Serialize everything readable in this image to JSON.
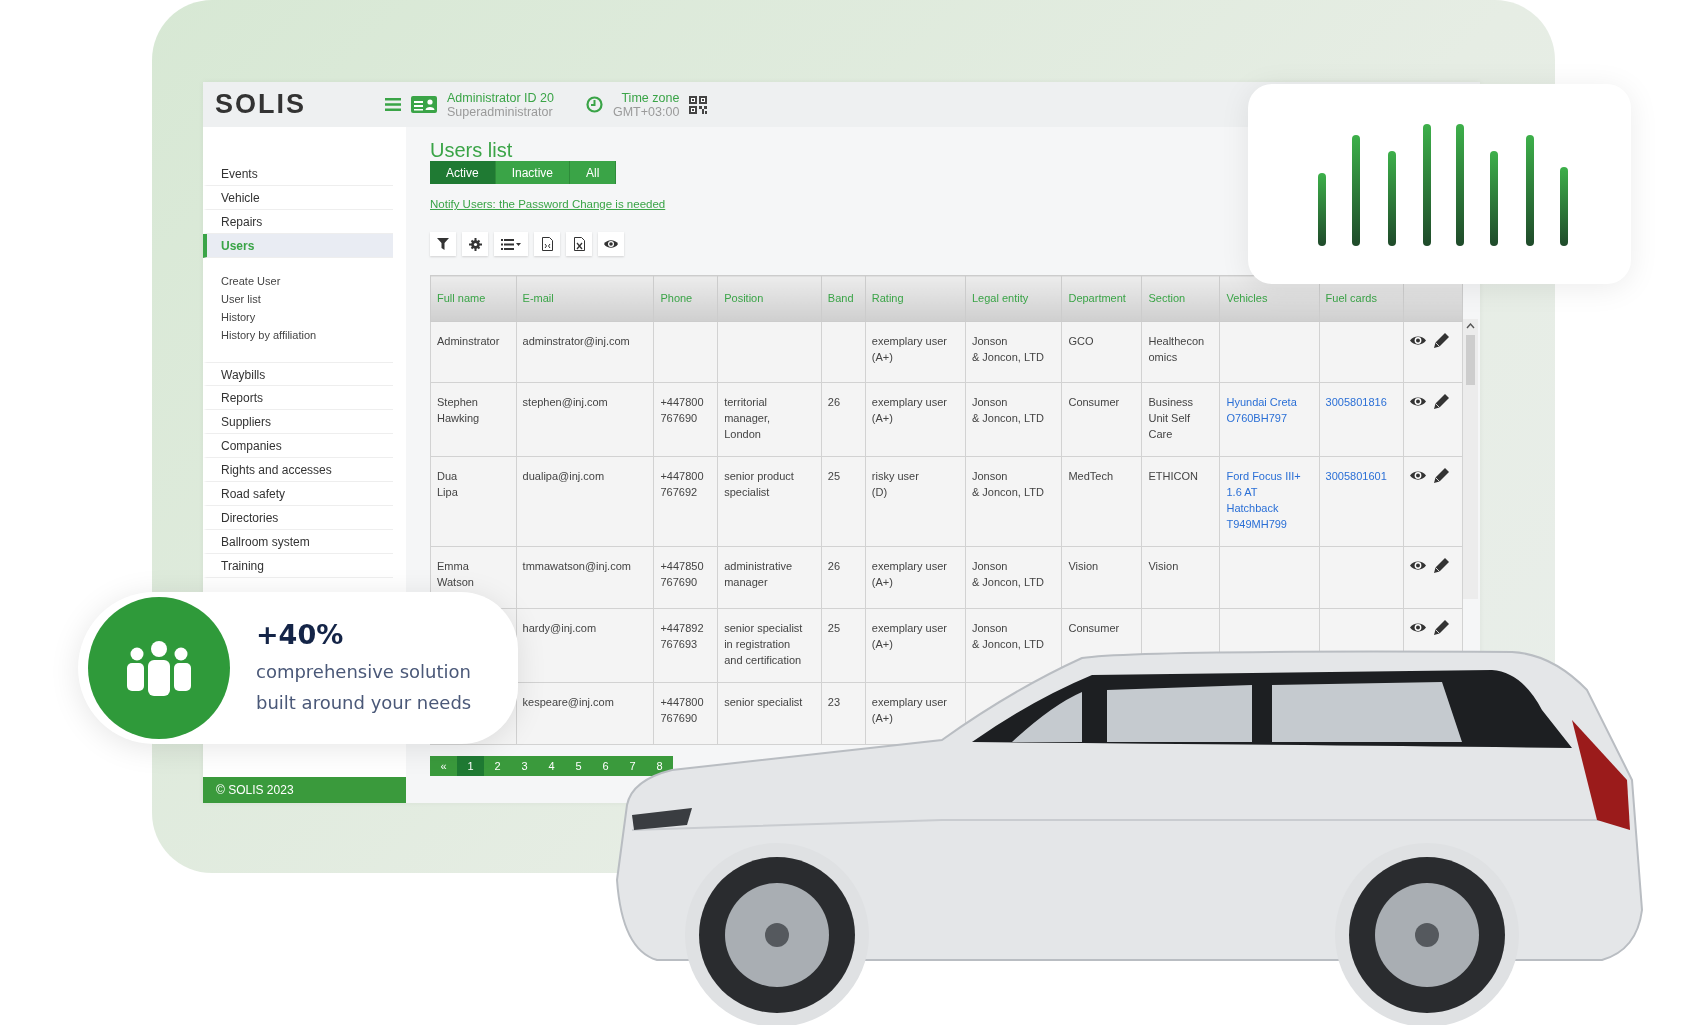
{
  "header": {
    "logo": "SOLIS",
    "user_name": "Administrator ID 20",
    "user_role": "Superadministrator",
    "timezone_label": "Time zone",
    "timezone_value": "GMT+03:00"
  },
  "sidebar": {
    "items": [
      {
        "label": "Events",
        "kind": "main",
        "selected": false
      },
      {
        "label": "Vehicle",
        "kind": "main",
        "selected": false
      },
      {
        "label": "Repairs",
        "kind": "main",
        "selected": false
      },
      {
        "label": "Users",
        "kind": "main",
        "selected": true
      },
      {
        "label": "Create User",
        "kind": "sub",
        "selected": false
      },
      {
        "label": "User list",
        "kind": "sub",
        "selected": false
      },
      {
        "label": "History",
        "kind": "sub",
        "selected": false
      },
      {
        "label": "History by affiliation",
        "kind": "sub",
        "selected": false
      },
      {
        "label": "Waybills",
        "kind": "main",
        "selected": false
      },
      {
        "label": "Reports",
        "kind": "main",
        "selected": false
      },
      {
        "label": "Suppliers",
        "kind": "main",
        "selected": false
      },
      {
        "label": "Companies",
        "kind": "main",
        "selected": false
      },
      {
        "label": "Rights and accesses",
        "kind": "main",
        "selected": false
      },
      {
        "label": "Road safety",
        "kind": "main",
        "selected": false
      },
      {
        "label": "Directories",
        "kind": "main",
        "selected": false
      },
      {
        "label": "Ballroom system",
        "kind": "main",
        "selected": false
      },
      {
        "label": "Training",
        "kind": "main",
        "selected": false
      }
    ],
    "footer": "© SOLIS 2023"
  },
  "page": {
    "title": "Users list",
    "tabs": [
      {
        "label": "Active",
        "selected": true
      },
      {
        "label": "Inactive",
        "selected": false
      },
      {
        "label": "All",
        "selected": false
      }
    ],
    "notice_link": "Notify Users: the Password Change is needed",
    "toolbar": [
      {
        "kind": "filter"
      },
      {
        "kind": "settings"
      },
      {
        "kind": "list"
      },
      {
        "kind": "document"
      },
      {
        "kind": "excel"
      },
      {
        "kind": "view"
      }
    ]
  },
  "table": {
    "columns": [
      {
        "label": "Full name",
        "kind": "text"
      },
      {
        "label": "E-mail",
        "kind": "text"
      },
      {
        "label": "Phone",
        "kind": "text"
      },
      {
        "label": "Position",
        "kind": "text"
      },
      {
        "label": "Band",
        "kind": "text"
      },
      {
        "label": "Rating",
        "kind": "text"
      },
      {
        "label": "Legal entity",
        "kind": "text"
      },
      {
        "label": "Department",
        "kind": "text"
      },
      {
        "label": "Section",
        "kind": "text"
      },
      {
        "label": "Vehicles",
        "kind": "link"
      },
      {
        "label": "Fuel cards",
        "kind": "link"
      },
      {
        "kind": "actions"
      }
    ],
    "rows": [
      {
        "actions": true,
        "cells": [
          "Adminstrator",
          "adminstrator@inj.com",
          null,
          null,
          null,
          "exemplary user\n(A+)",
          "Jonson\n& Joncon, LTD",
          "GCO",
          "Healthecon\nomics",
          null,
          null
        ]
      },
      {
        "actions": true,
        "cells": [
          "Stephen\nHawking",
          "stephen@inj.com",
          "+447800\n767690",
          "territorial\nmanager,\nLondon",
          "26",
          "exemplary user\n(A+)",
          "Jonson\n& Joncon, LTD",
          "Consumer",
          "Business\nUnit Self\nCare",
          "Hyundai Creta\nO760BH797",
          "3005801816"
        ]
      },
      {
        "actions": true,
        "cells": [
          "Dua\nLipa",
          "dualipa@inj.com",
          "+447800\n767692",
          "senior product\nspecialist",
          "25",
          "risky user\n(D)",
          "Jonson\n& Joncon, LTD",
          "MedTech",
          "ETHICON",
          "Ford Focus III+\n1.6 AT\nHatchback\nT949MH799",
          "3005801601"
        ]
      },
      {
        "actions": true,
        "cells": [
          "Emma\nWatson",
          "tmmawatson@inj.com",
          "+447850\n767690",
          "administrative\nmanager",
          "26",
          "exemplary user\n(A+)",
          "Jonson\n& Joncon, LTD",
          "Vision",
          "Vision",
          null,
          null
        ]
      },
      {
        "actions": true,
        "cells": [
          null,
          "hardy@inj.com",
          "+447892\n767693",
          "senior specialist\nin registration\nand certification",
          "25",
          "exemplary user\n(A+)",
          "Jonson\n& Joncon, LTD",
          "Consumer",
          null,
          null,
          null
        ]
      },
      {
        "actions": false,
        "cells": [
          null,
          "kespeare@inj.com",
          "+447800\n767690",
          "senior specialist",
          "23",
          "exemplary user\n(A+)",
          null,
          null,
          null,
          null,
          null
        ]
      }
    ]
  },
  "pagination": {
    "prev": "«",
    "pages": [
      {
        "label": "1",
        "selected": true
      },
      {
        "label": "2",
        "selected": false
      },
      {
        "label": "3",
        "selected": false
      },
      {
        "label": "4",
        "selected": false
      },
      {
        "label": "5",
        "selected": false
      },
      {
        "label": "6",
        "selected": false
      },
      {
        "label": "7",
        "selected": false
      },
      {
        "label": "8",
        "selected": false
      }
    ]
  },
  "stats_card": {
    "figure": "+40%",
    "caption": "comprehensive solution\nbuilt around your needs"
  }
}
